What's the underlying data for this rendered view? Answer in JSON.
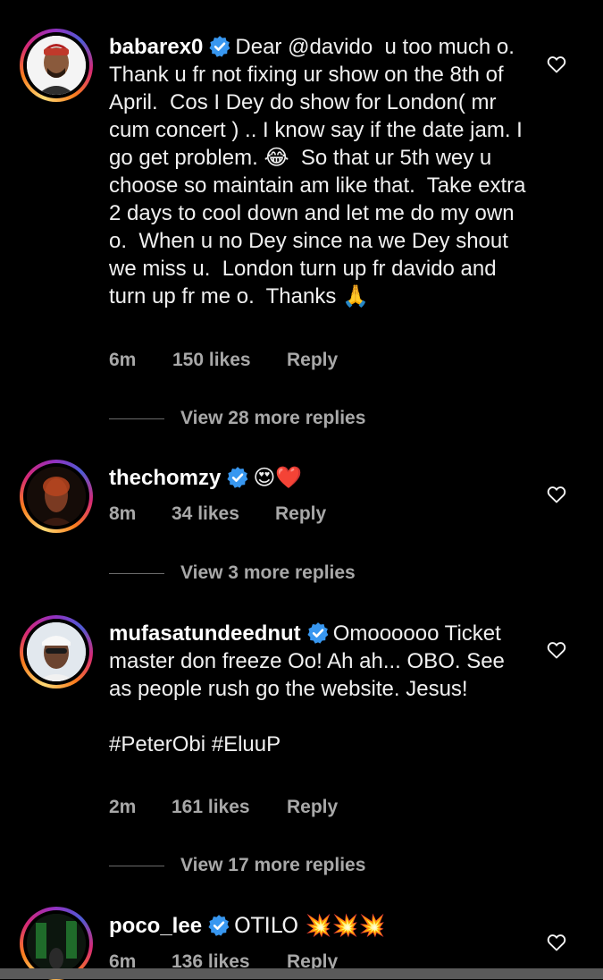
{
  "comments": [
    {
      "username": "babarex0",
      "text": "Dear @davido  u too much o. Thank u fr not fixing ur show on the 8th of April.  Cos I Dey do show for London( mr cum concert ) .. I know say if the date jam. I go get problem. 😂  So that ur 5th wey u choose so maintain am like that.  Take extra 2 days to cool down and let me do my own o.  When u no Dey since na we Dey shout we miss u.  London turn up fr davido and turn up fr me o.  Thanks 🙏",
      "time": "6m",
      "likes": "150 likes",
      "reply": "Reply",
      "view_replies": "View 28 more replies"
    },
    {
      "username": "thechomzy",
      "text": "😍❤️",
      "time": "8m",
      "likes": "34 likes",
      "reply": "Reply",
      "view_replies": "View 3 more replies"
    },
    {
      "username": "mufasatundeednut",
      "text": "Omoooooo Ticket master don freeze Oo! Ah ah... OBO. See as people rush go the website. Jesus!\n\n#PeterObi #EluuP",
      "time": "2m",
      "likes": "161 likes",
      "reply": "Reply",
      "view_replies": "View 17 more replies"
    },
    {
      "username": "poco_lee",
      "text": "OTILO 💥💥💥",
      "time": "6m",
      "likes": "136 likes",
      "reply": "Reply"
    }
  ],
  "icons": {
    "verified": "verified-badge-icon",
    "like": "heart-outline-icon"
  },
  "colors": {
    "background": "#000000",
    "verified": "#3897f0",
    "meta_text": "#a8a8a8"
  }
}
